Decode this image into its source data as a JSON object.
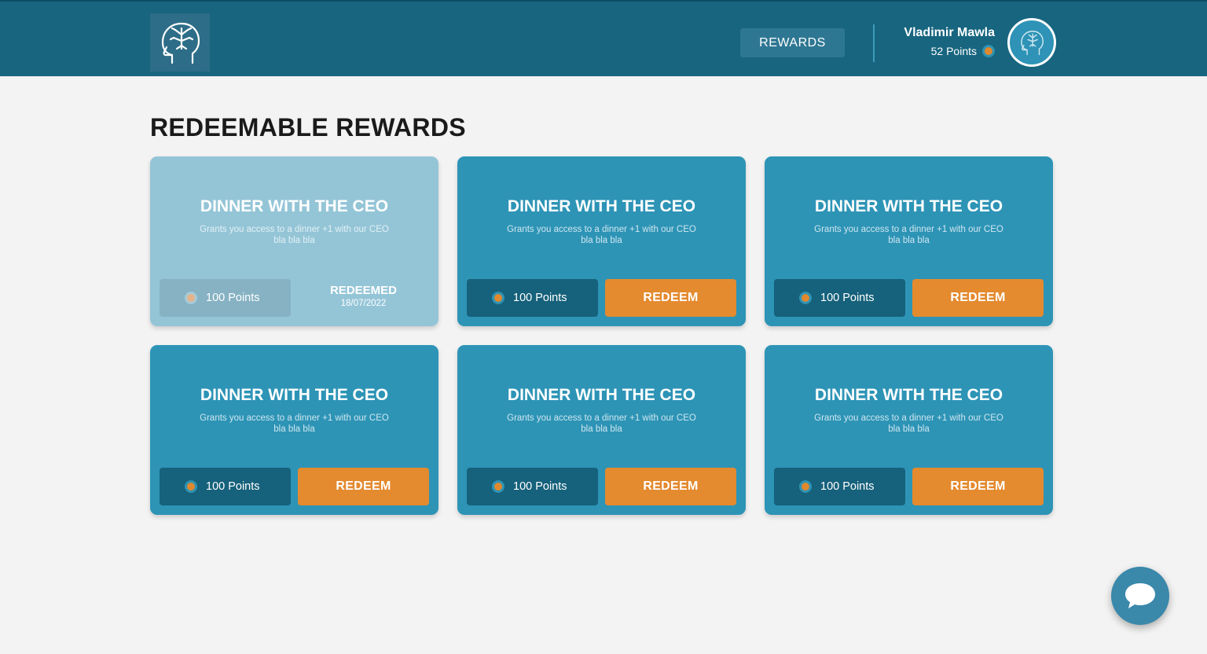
{
  "header": {
    "logo_icon": "brain-head-icon",
    "nav_rewards_label": "REWARDS",
    "user": {
      "name": "Vladimir Mawla",
      "points": "52 Points",
      "avatar_icon": "brain-head-icon"
    }
  },
  "main": {
    "title": "REDEEMABLE REWARDS",
    "rewards": [
      {
        "title": "DINNER WITH THE CEO",
        "desc_line1": "Grants you access to a dinner +1 with our CEO",
        "desc_line2": "bla bla bla",
        "points": "100 Points",
        "status": "redeemed",
        "redeemed_label": "REDEEMED",
        "redeemed_date": "18/07/2022"
      },
      {
        "title": "DINNER WITH THE CEO",
        "desc_line1": "Grants you access to a dinner +1 with our CEO",
        "desc_line2": "bla bla bla",
        "points": "100 Points",
        "status": "available",
        "button_label": "REDEEM"
      },
      {
        "title": "DINNER WITH THE CEO",
        "desc_line1": "Grants you access to a dinner +1 with our CEO",
        "desc_line2": "bla bla bla",
        "points": "100 Points",
        "status": "available",
        "button_label": "REDEEM"
      },
      {
        "title": "DINNER WITH THE CEO",
        "desc_line1": "Grants you access to a dinner +1 with our CEO",
        "desc_line2": "bla bla bla",
        "points": "100 Points",
        "status": "available",
        "button_label": "REDEEM"
      },
      {
        "title": "DINNER WITH THE CEO",
        "desc_line1": "Grants you access to a dinner +1 with our CEO",
        "desc_line2": "bla bla bla",
        "points": "100 Points",
        "status": "available",
        "button_label": "REDEEM"
      },
      {
        "title": "DINNER WITH THE CEO",
        "desc_line1": "Grants you access to a dinner +1 with our CEO",
        "desc_line2": "bla bla bla",
        "points": "100 Points",
        "status": "available",
        "button_label": "REDEEM"
      }
    ]
  },
  "chat": {
    "icon": "chat-bubble-icon"
  },
  "colors": {
    "header_bg": "#17657f",
    "card_bg": "#2d94b6",
    "card_redeemed_bg": "#94c5d7",
    "accent_orange": "#e48a2f",
    "points_pill_bg": "#16617b"
  }
}
